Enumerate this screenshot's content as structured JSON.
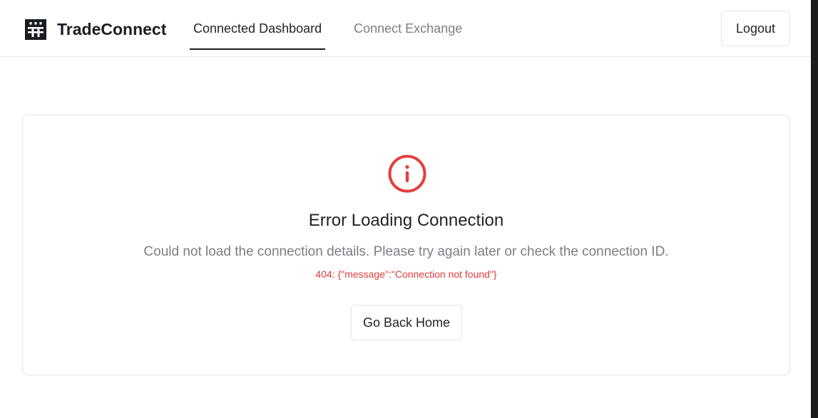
{
  "app": {
    "brand_name": "TradeConnect",
    "logo_icon": "grid-logo-icon"
  },
  "nav": {
    "tabs": [
      {
        "label": "Connected Dashboard",
        "active": true
      },
      {
        "label": "Connect Exchange",
        "active": false
      }
    ]
  },
  "header": {
    "logout_label": "Logout"
  },
  "error": {
    "icon": "alert-circle-icon",
    "title": "Error Loading Connection",
    "description": "Could not load the connection details. Please try again later or check the connection ID.",
    "detail": "404: {\"message\":\"Connection not found\"}",
    "home_button_label": "Go Back Home"
  },
  "colors": {
    "error_red": "#e53e3e",
    "text_primary": "#1f2328",
    "text_muted": "#7a7e85",
    "border": "#e2e4e7"
  }
}
